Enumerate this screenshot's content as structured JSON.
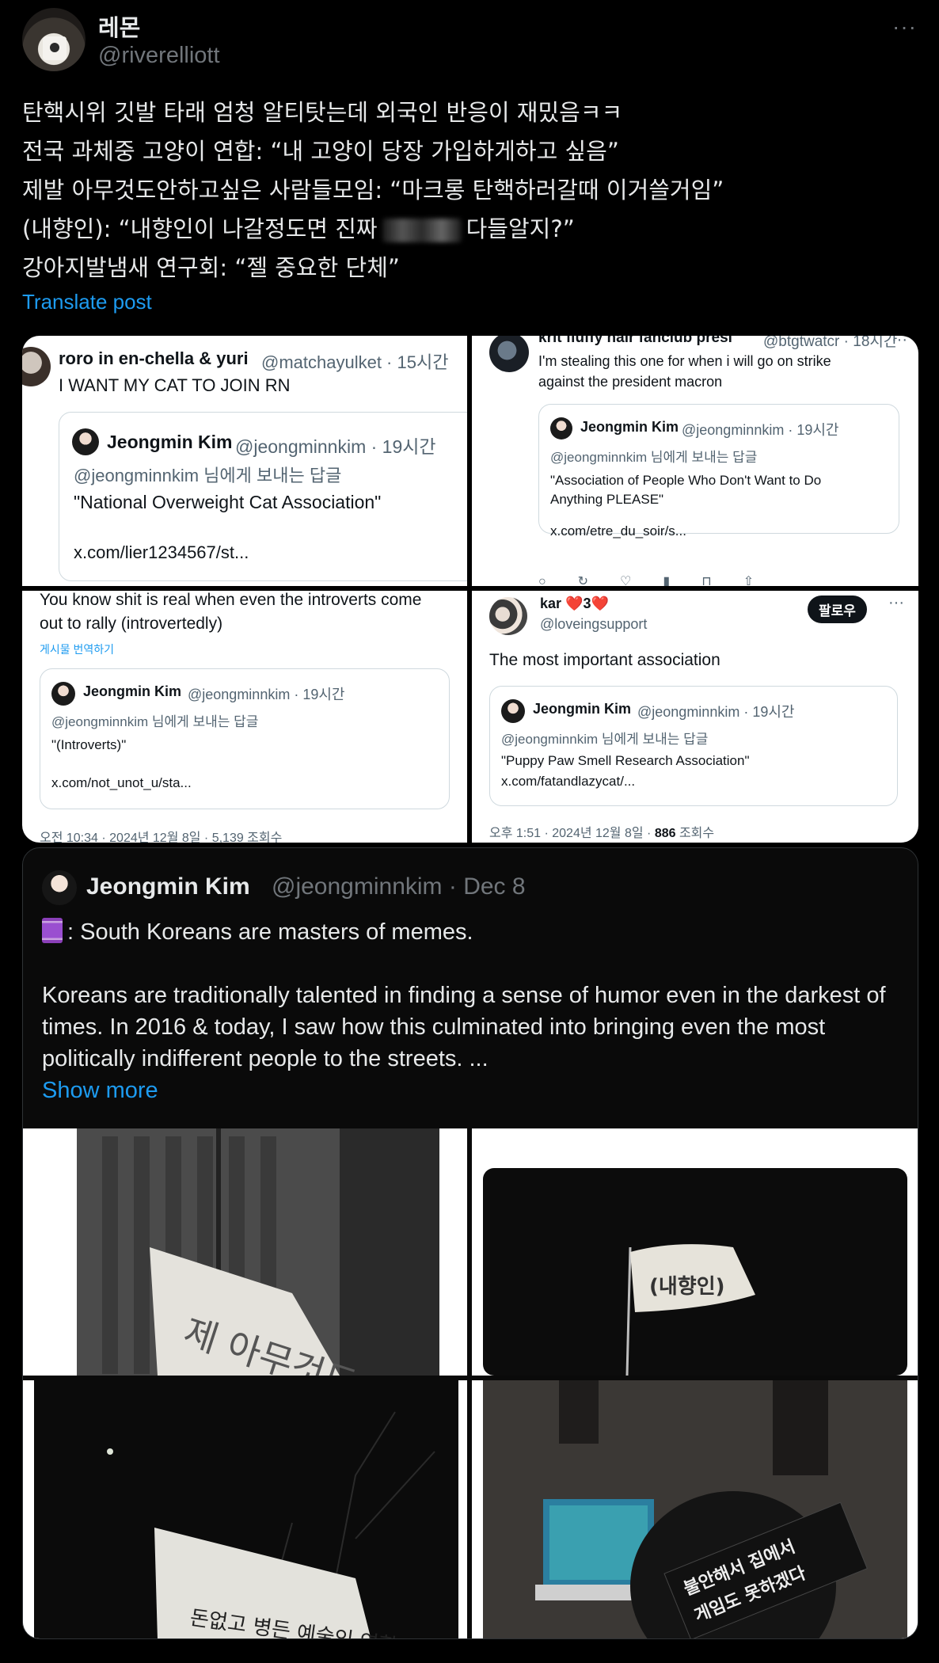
{
  "post": {
    "display_name": "레몬",
    "handle": "@riverelliott",
    "more": "···",
    "lines": [
      "탄핵시위 깃발 타래 엄청 알티탓는데 외국인 반응이 재밌음ㅋㅋ",
      "전국 과체중 고양이 연합: “내 고양이 당장 가입하게하고 싶음”",
      "제발 아무것도안하고싶은 사람들모임: “마크롱 탄핵하러갈때 이거쓸거임”",
      "(내향인): “내향인이 나갈정도면 진짜",
      "다들알지?”",
      "강아지발냄새 연구회: “젤 중요한 단체”"
    ],
    "translate": "Translate post"
  },
  "shots": [
    {
      "name": "roro in en-chella & yuri",
      "handle": "@matchayulket · 15시간",
      "text": "I WANT MY CAT TO JOIN RN",
      "quote_name": "Jeongmin Kim",
      "quote_handle": "@jeongminnkim · 19시간",
      "reply_to": "@jeongminnkim 님에게 보내는 답글",
      "quote_text": "\"National Overweight Cat Association\"",
      "quote_link": "x.com/lier1234567/st..."
    },
    {
      "name": "krit fluffy hair fanclub presi",
      "handle": "@btgtwatcr · 18시간",
      "text_1": "I'm stealing this one for when i will go on strike",
      "text_2": "against the president macron",
      "quote_name": "Jeongmin Kim",
      "quote_handle": "@jeongminnkim · 19시간",
      "reply_to": "@jeongminnkim 님에게 보내는 답글",
      "quote_text_1": "\"Association of People Who Don't Want to Do",
      "quote_text_2": "Anything PLEASE\"",
      "quote_link": "x.com/etre_du_soir/s..."
    },
    {
      "text_1": "You know shit is real when even the introverts come",
      "text_2": "out to rally (introvertedly)",
      "translate": "게시물 번역하기",
      "quote_name": "Jeongmin Kim",
      "quote_handle": "@jeongminnkim · 19시간",
      "reply_to": "@jeongminnkim 님에게 보내는 답글",
      "quote_text": "\"(Introverts)\"",
      "quote_link": "x.com/not_unot_u/sta...",
      "footer": "오전 10:34 · 2024년 12월 8일 · 5,139 조회수"
    },
    {
      "name": "kar ❤️3❤️",
      "handle": "@loveingsupport",
      "follow": "팔로우",
      "text": "The most important association",
      "quote_name": "Jeongmin Kim",
      "quote_handle": "@jeongminnkim · 19시간",
      "reply_to": "@jeongminnkim 님에게 보내는 답글",
      "quote_text": "\"Puppy Paw Smell Research Association\"",
      "quote_link": "x.com/fatandlazycat/...",
      "footer_time": "오후 1:51 · 2024년 12월 8일 · ",
      "footer_views": "886",
      "footer_suffix": " 조회수"
    }
  ],
  "quote": {
    "name": "Jeongmin Kim",
    "handle": "@jeongminnkim · Dec 8",
    "line1": ": South Koreans are masters of memes.",
    "para": "Koreans are traditionally talented in finding a sense of humor even in the darkest of times. In 2016 & today, I saw how this culminated into bringing even the most politically indifferent people to the streets. ...",
    "show_more": "Show more"
  },
  "photos": {
    "flag1_text": "제 아무것도 안 하고 싶은 발 사람들",
    "flag2_text": "(내향인)",
    "flag3_text": "돈없고 병든 예술인 연합",
    "sign4_line1": "불안해서 집에서",
    "sign4_line2": "게임도 못하겠다"
  }
}
